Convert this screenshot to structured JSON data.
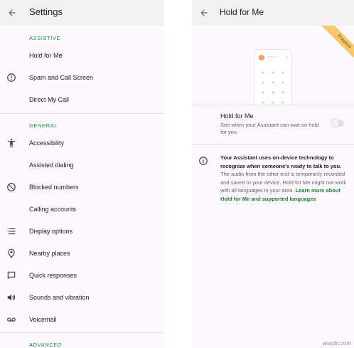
{
  "left": {
    "title": "Settings",
    "sections": {
      "assistive": "ASSISTIVE",
      "general": "GENERAL",
      "advanced": "ADVANCED"
    },
    "assistive_items": [
      {
        "label": "Hold for Me",
        "icon": ""
      },
      {
        "label": "Spam and Call Screen",
        "icon": "alert-circle-icon"
      },
      {
        "label": "Direct My Call",
        "icon": ""
      }
    ],
    "general_items": [
      {
        "label": "Accessibility",
        "icon": "accessibility-icon"
      },
      {
        "label": "Assisted dialing",
        "icon": ""
      },
      {
        "label": "Blocked numbers",
        "icon": "block-icon"
      },
      {
        "label": "Calling accounts",
        "icon": ""
      },
      {
        "label": "Display options",
        "icon": "list-icon"
      },
      {
        "label": "Nearby places",
        "icon": "location-pin-icon"
      },
      {
        "label": "Quick responses",
        "icon": "message-icon"
      },
      {
        "label": "Sounds and vibration",
        "icon": "volume-icon"
      },
      {
        "label": "Voicemail",
        "icon": "voicemail-icon"
      }
    ]
  },
  "right": {
    "title": "Hold for Me",
    "preview_badge": "Preview",
    "setting": {
      "title": "Hold for Me",
      "subtitle": "See when your Assistant can wait on hold for you",
      "enabled": false
    },
    "info": {
      "bold_text": "Your Assistant uses on-device technology to recognize when someone's ready to talk to you.",
      "body_text": " The audio from the other end is temporarily recorded and saved to your device. Hold for Me might not work with all languages in your area. ",
      "link_text": "Learn more about Hold for Me and supported languages"
    }
  },
  "watermark": "wsxdn.com",
  "colors": {
    "accent_green": "#1e8e3e",
    "panel_bg": "#fdf8fd",
    "appbar_bg": "#f1f1f1",
    "preview_badge": "#f6c96b"
  }
}
